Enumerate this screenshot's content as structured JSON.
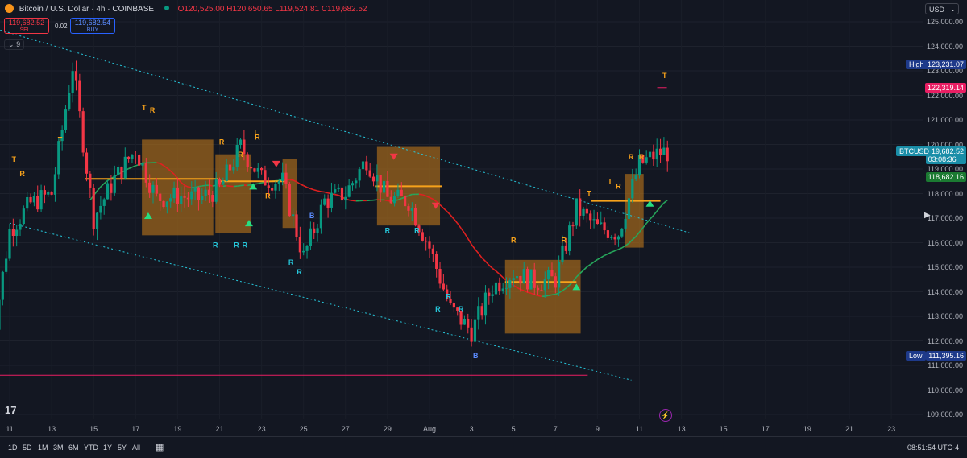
{
  "header": {
    "symbol_title": "Bitcoin / U.S. Dollar · 4h · COINBASE",
    "ohlc": {
      "o": "O120,525.00",
      "h": "H120,650.65",
      "l": "L119,524.81",
      "c": "C119,682.52"
    },
    "sell_price": "119,682.52",
    "sell_label": "SELL",
    "buy_price": "119,682.54",
    "buy_label": "BUY",
    "spread": "0.02",
    "indicator_count": "9"
  },
  "currency_button": "USD",
  "price_axis": {
    "ticks": [
      "125,000.00",
      "124,000.00",
      "123,000.00",
      "122,000.00",
      "121,000.00",
      "120,000.00",
      "119,000.00",
      "118,000.00",
      "117,000.00",
      "116,000.00",
      "115,000.00",
      "114,000.00",
      "113,000.00",
      "112,000.00",
      "111,000.00",
      "110,000.00",
      "109,000.00"
    ],
    "high_label": "High",
    "high_value": "123,231.07",
    "low_label": "Low",
    "low_value": "111,395.16",
    "resistance_value": "122,319.14",
    "symbol_tag": "BTCUSD",
    "last_price": "119,682.52",
    "countdown": "03:08:36",
    "ma_value": "118,682.16"
  },
  "time_axis": {
    "labels": [
      "11",
      "13",
      "15",
      "17",
      "19",
      "21",
      "23",
      "25",
      "27",
      "29",
      "Aug",
      "3",
      "5",
      "7",
      "9",
      "11",
      "13",
      "15",
      "17",
      "19",
      "21",
      "23"
    ]
  },
  "ranges": [
    "1D",
    "5D",
    "1M",
    "3M",
    "6M",
    "YTD",
    "1Y",
    "5Y",
    "All"
  ],
  "clock": "08:51:54 UTC-4",
  "colors": {
    "up": "#089981",
    "down": "#f23645",
    "band": "#b8741a",
    "level": "#f7a21b",
    "ma_green": "#26a65b",
    "ma_red": "#e02020",
    "channel": "#26c6da",
    "support": "#e91e63"
  },
  "markers": {
    "top": "T",
    "resistance": "R",
    "bottom": "B"
  },
  "icons": {
    "coin": "bitcoin-icon",
    "calendar": "calendar-icon",
    "alert": "alert-clock-icon",
    "logo": "tradingview-logo"
  },
  "logo_text": "17",
  "chart_data": {
    "type": "candlestick",
    "symbol": "BTCUSD",
    "timeframe": "4h",
    "ylim": [
      108800,
      125400
    ],
    "series_sample": [
      {
        "date": "Jul 10",
        "close": 111000
      },
      {
        "date": "Jul 11",
        "close": 116500
      },
      {
        "date": "Jul 12",
        "close": 117600
      },
      {
        "date": "Jul 13",
        "close": 118000
      },
      {
        "date": "Jul 14",
        "close": 123200
      },
      {
        "date": "Jul 15",
        "close": 117000
      },
      {
        "date": "Jul 16",
        "close": 118600
      },
      {
        "date": "Jul 17",
        "close": 119800
      },
      {
        "date": "Jul 18",
        "close": 117800
      },
      {
        "date": "Jul 19",
        "close": 117900
      },
      {
        "date": "Jul 20",
        "close": 117800
      },
      {
        "date": "Jul 21",
        "close": 118200
      },
      {
        "date": "Jul 22",
        "close": 119900
      },
      {
        "date": "Jul 23",
        "close": 118600
      },
      {
        "date": "Jul 24",
        "close": 118500
      },
      {
        "date": "Jul 25",
        "close": 115400
      },
      {
        "date": "Jul 26",
        "close": 117700
      },
      {
        "date": "Jul 27",
        "close": 118000
      },
      {
        "date": "Jul 28",
        "close": 119400
      },
      {
        "date": "Jul 29",
        "close": 117800
      },
      {
        "date": "Jul 30",
        "close": 117700
      },
      {
        "date": "Jul 31",
        "close": 115800
      },
      {
        "date": "Aug 1",
        "close": 113300
      },
      {
        "date": "Aug 2",
        "close": 112400
      },
      {
        "date": "Aug 3",
        "close": 114200
      },
      {
        "date": "Aug 4",
        "close": 114800
      },
      {
        "date": "Aug 5",
        "close": 114400
      },
      {
        "date": "Aug 6",
        "close": 114500
      },
      {
        "date": "Aug 7",
        "close": 117400
      },
      {
        "date": "Aug 8",
        "close": 116600
      },
      {
        "date": "Aug 9",
        "close": 116400
      },
      {
        "date": "Aug 10",
        "close": 119200
      },
      {
        "date": "Aug 11",
        "close": 119682
      }
    ],
    "channel_upper": [
      {
        "date": "Jul 10",
        "y": 124800
      },
      {
        "date": "Aug 12",
        "y": 116400
      }
    ],
    "channel_lower": [
      {
        "date": "Jul 11",
        "y": 116800
      },
      {
        "date": "Aug 10",
        "y": 110400
      }
    ],
    "support_line": {
      "from": "Jul 10",
      "to": "Aug 7",
      "y": 110600
    },
    "resistance_line": {
      "from": "Aug 11",
      "to": "Aug 11",
      "y": 122319
    }
  }
}
